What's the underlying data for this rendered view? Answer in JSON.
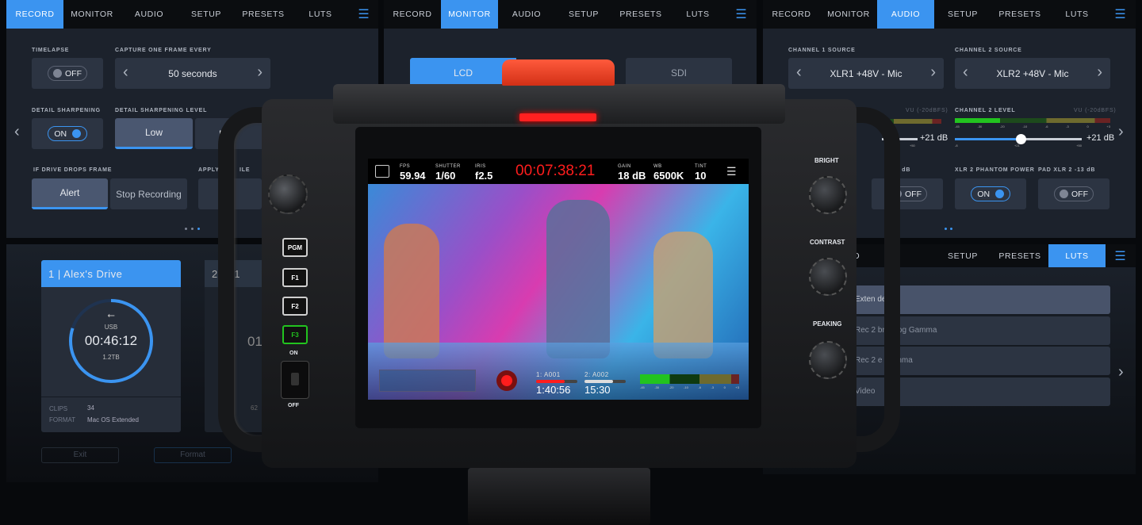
{
  "colors": {
    "accent": "#3b94f0",
    "record": "#ff1d1d",
    "meter_green": "#22c31f"
  },
  "tabs": [
    "RECORD",
    "MONITOR",
    "AUDIO",
    "SETUP",
    "PRESETS",
    "LUTS"
  ],
  "record_panel": {
    "active_tab": "RECORD",
    "timelapse": {
      "label": "TIMELAPSE",
      "value": "OFF"
    },
    "capture": {
      "label": "CAPTURE ONE FRAME EVERY",
      "value": "50 seconds"
    },
    "detail_sharpening": {
      "label": "DETAIL SHARPENING",
      "value": "ON"
    },
    "detail_level": {
      "label": "DETAIL SHARPENING LEVEL",
      "options": [
        "Low",
        "M"
      ],
      "selected": "Low"
    },
    "drive_drops": {
      "label": "IF DRIVE DROPS FRAME",
      "options": [
        "Alert",
        "Stop Recording"
      ],
      "selected": "Alert"
    },
    "apply_label": "APPLY",
    "apply_label_tail": "ILE"
  },
  "monitor_panel": {
    "active_tab": "MONITOR",
    "outputs": [
      "LCD",
      "SDI"
    ],
    "selected": "LCD"
  },
  "audio_panel": {
    "active_tab": "AUDIO",
    "ch1_source": {
      "label": "CHANNEL 1 SOURCE",
      "value": "XLR1 +48V - Mic"
    },
    "ch2_source": {
      "label": "CHANNEL 2 SOURCE",
      "value": "XLR2 +48V - Mic"
    },
    "vu_label": "VU (-20dBFS)",
    "ch1_level": {
      "value": "+21 dB",
      "scale_max": "+50"
    },
    "ch2_level": {
      "label": "CHANNEL 2 LEVEL",
      "value": "+21 dB",
      "level_fraction": 0.52,
      "scale_min": "-8",
      "scale_mid": "+21",
      "scale_max": "+50",
      "meter_ticks": [
        "-45",
        "-30",
        "-20",
        "-10",
        "-6",
        "-3",
        "0",
        "+3"
      ]
    },
    "pad1": {
      "label_tail": "-13 dB",
      "value": "OFF"
    },
    "phantom2": {
      "label": "XLR 2 PHANTOM POWER",
      "value": "ON"
    },
    "pad2": {
      "label": "PAD XLR 2 -13 dB",
      "value": "OFF"
    }
  },
  "media_panel": {
    "drive1": {
      "title": "1 | Alex's Drive",
      "type": "USB",
      "time": "00:46:12",
      "capacity": "1.2TB",
      "fill_fraction": 0.8,
      "clips_label": "CLIPS",
      "clips": "34",
      "format_label": "FORMAT",
      "format": "Mac OS Extended"
    },
    "drive2": {
      "title_visible": "2",
      "title_tail": "ve 1",
      "time_partial": "01",
      "clips": "62"
    },
    "exit": "Exit",
    "format_button": "Format"
  },
  "luts_panel": {
    "active_tab": "LUTS",
    "visible_tabs": [
      "OR",
      "UDIO",
      "SETUP",
      "PRESETS",
      "LUTS"
    ],
    "items": [
      {
        "a": "Exten",
        "b": "deo"
      },
      {
        "a": "Rec 2",
        "b": "brid Log Gamma"
      },
      {
        "a": "Rec 2",
        "b": "e Gamma"
      },
      {
        "a": "Video",
        "b": ""
      }
    ]
  },
  "camera": {
    "left_buttons": [
      "PGM",
      "F1",
      "F2",
      "F3"
    ],
    "switch_on": "ON",
    "switch_off": "OFF",
    "knobs": [
      "BRIGHT",
      "CONTRAST",
      "PEAKING"
    ],
    "screen": {
      "fps": {
        "label": "FPS",
        "value": "59.94"
      },
      "shutter": {
        "label": "SHUTTER",
        "value": "1/60"
      },
      "iris": {
        "label": "IRIS",
        "value": "f2.5"
      },
      "timecode": "00:07:38:21",
      "gain": {
        "label": "GAIN",
        "value": "18 dB"
      },
      "wb": {
        "label": "WB",
        "value": "6500K"
      },
      "tint": {
        "label": "TINT",
        "value": "10"
      },
      "card1": {
        "label": "1: A001",
        "remaining": "1:40:56",
        "fill_fraction": 0.7
      },
      "card2": {
        "label": "2: A002",
        "remaining": "15:30",
        "fill_fraction": 0.7
      },
      "meter_ticks": [
        "-45",
        "-30",
        "-20",
        "-10",
        "-6",
        "-3",
        "0",
        "+3"
      ]
    }
  }
}
